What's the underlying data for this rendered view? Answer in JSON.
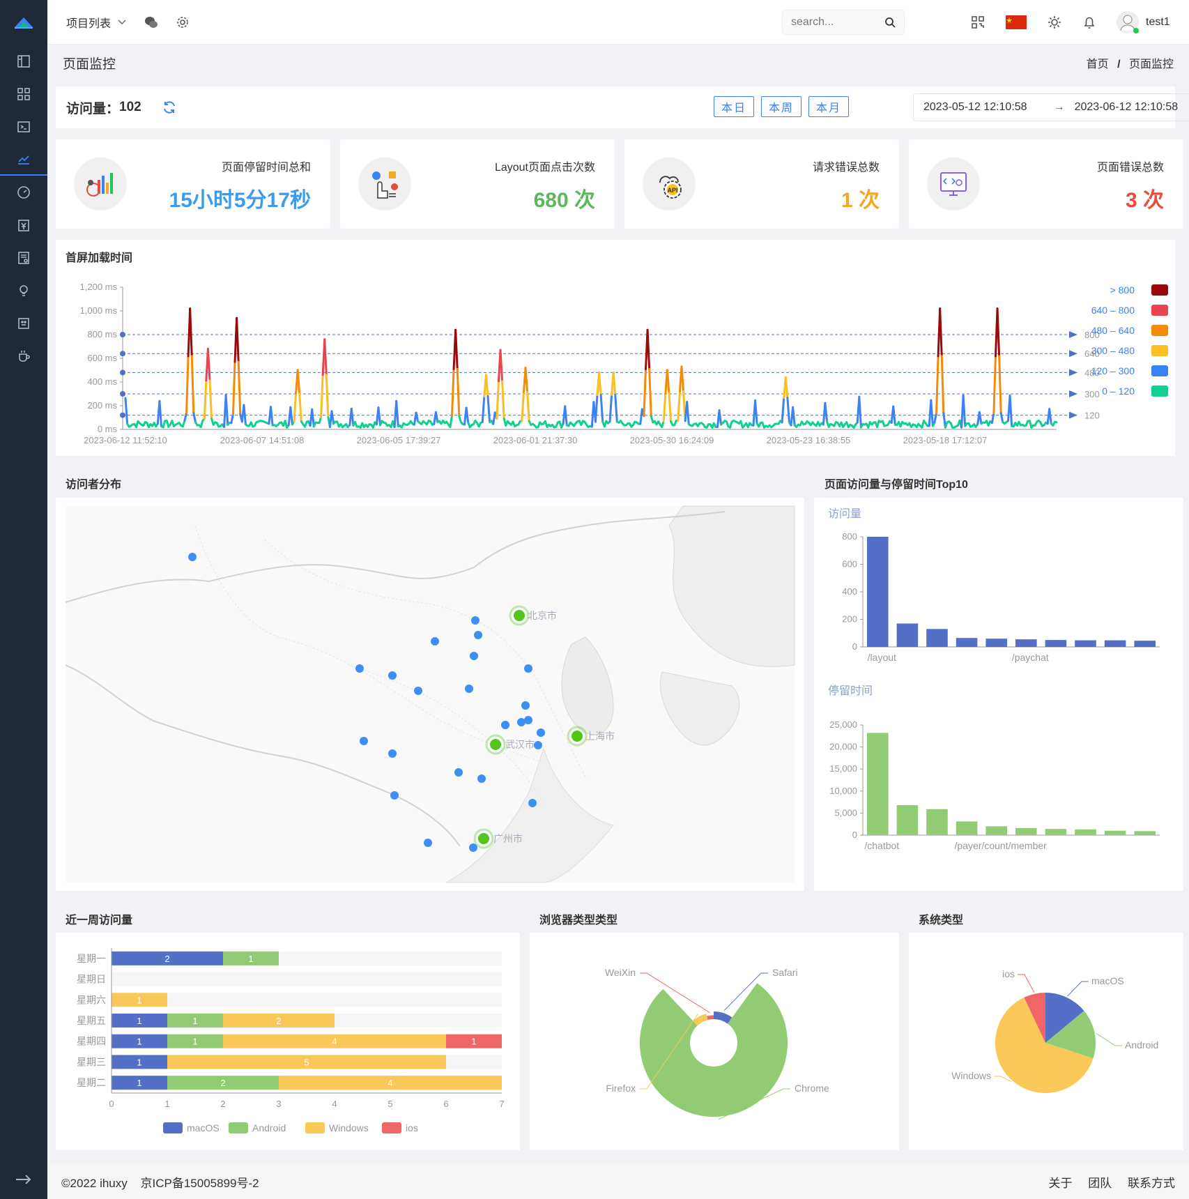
{
  "header": {
    "project_menu": "项目列表",
    "search_placeholder": "search...",
    "username": "test1"
  },
  "page": {
    "title": "页面监控",
    "breadcrumb_home": "首页",
    "breadcrumb_sep": "/",
    "breadcrumb_current": "页面监控"
  },
  "filter": {
    "pv_label": "访问量：",
    "pv_value": "102",
    "btn_today": "本日",
    "btn_week": "本周",
    "btn_month": "本月",
    "start": "2023-05-12 12:10:58",
    "arrow": "→",
    "end": "2023-06-12 12:10:58"
  },
  "stats": [
    {
      "label": "页面停留时间总和",
      "value": "15小时5分17秒",
      "color": "#3b9bef"
    },
    {
      "label": "Layout页面点击次数",
      "value": "680 次",
      "color": "#5cb85c"
    },
    {
      "label": "请求错误总数",
      "value": "1 次",
      "color": "#f5a623"
    },
    {
      "label": "页面错误总数",
      "value": "3 次",
      "color": "#e74c3c"
    }
  ],
  "sections": {
    "load_time": "首屏加载时间",
    "visitors": "访问者分布",
    "top10": "页面访问量与停留时间Top10",
    "week": "近一周访问量",
    "browser": "浏览器类型类型",
    "os": "系统类型"
  },
  "chart_data": [
    {
      "type": "line",
      "title": "首屏加载时间",
      "ylim": [
        0,
        1200
      ],
      "yticks": [
        "1,200 ms",
        "1,000 ms",
        "800 ms",
        "600 ms",
        "400 ms",
        "200 ms",
        "0 ms"
      ],
      "x_labels": [
        "2023-06-12 11:52:10",
        "2023-06-07 14:51:08",
        "2023-06-05 17:39:27",
        "2023-06-01 21:37:30",
        "2023-05-30 16:24:09",
        "2023-05-23 16:38:55",
        "2023-05-18 17:12:07"
      ],
      "thresholds": [
        800,
        640,
        480,
        300,
        120
      ],
      "legend": [
        {
          "label": "> 800",
          "color": "#9b0a0a"
        },
        {
          "label": "640 – 800",
          "color": "#e8434f"
        },
        {
          "label": "480 – 640",
          "color": "#f58a07"
        },
        {
          "label": "300 – 480",
          "color": "#fbbf24"
        },
        {
          "label": "120 – 300",
          "color": "#3b82f6"
        },
        {
          "label": "0 – 120",
          "color": "#10d090"
        }
      ],
      "peaks": [
        {
          "pos": 0.07,
          "value": 1020
        },
        {
          "pos": 0.088,
          "value": 680
        },
        {
          "pos": 0.12,
          "value": 940
        },
        {
          "pos": 0.185,
          "value": 500
        },
        {
          "pos": 0.213,
          "value": 760
        },
        {
          "pos": 0.354,
          "value": 840
        },
        {
          "pos": 0.388,
          "value": 460
        },
        {
          "pos": 0.402,
          "value": 670
        },
        {
          "pos": 0.43,
          "value": 520
        },
        {
          "pos": 0.509,
          "value": 480
        },
        {
          "pos": 0.525,
          "value": 480
        },
        {
          "pos": 0.56,
          "value": 840
        },
        {
          "pos": 0.582,
          "value": 500
        },
        {
          "pos": 0.597,
          "value": 530
        },
        {
          "pos": 0.71,
          "value": 440
        },
        {
          "pos": 0.875,
          "value": 1020
        },
        {
          "pos": 0.937,
          "value": 1020
        }
      ]
    },
    {
      "type": "bar",
      "title": "访问量",
      "categories": [
        "/layout",
        "",
        "",
        "",
        "",
        "/paychat",
        "",
        "",
        "",
        ""
      ],
      "values": [
        800,
        170,
        130,
        65,
        60,
        55,
        50,
        48,
        48,
        45
      ],
      "ylim": [
        0,
        800
      ],
      "yticks": [
        "800",
        "600",
        "400",
        "200",
        "0"
      ],
      "color": "#5470c6"
    },
    {
      "type": "bar",
      "title": "停留时间",
      "categories": [
        "/chatbot",
        "",
        "",
        "",
        "/payer/count/member",
        "",
        "",
        "",
        "",
        ""
      ],
      "values": [
        23200,
        6800,
        5900,
        3100,
        2000,
        1600,
        1400,
        1300,
        1000,
        900
      ],
      "ylim": [
        0,
        25000
      ],
      "yticks": [
        "25,000",
        "20,000",
        "15,000",
        "10,000",
        "5,000",
        "0"
      ],
      "color": "#91cc75"
    },
    {
      "type": "bar",
      "title": "近一周访问量",
      "orientation": "horizontal-stacked",
      "categories": [
        "星期一",
        "星期日",
        "星期六",
        "星期五",
        "星期四",
        "星期三",
        "星期二"
      ],
      "series": [
        {
          "name": "macOS",
          "values": [
            2,
            0,
            0,
            1,
            1,
            1,
            1
          ],
          "color": "#5470c6"
        },
        {
          "name": "Android",
          "values": [
            1,
            0,
            0,
            1,
            1,
            0,
            2
          ],
          "color": "#91cc75"
        },
        {
          "name": "Windows",
          "values": [
            0,
            0,
            1,
            2,
            4,
            5,
            4
          ],
          "color": "#fac858"
        },
        {
          "name": "ios",
          "values": [
            0,
            0,
            0,
            0,
            1,
            0,
            0
          ],
          "color": "#ee6666"
        }
      ],
      "xlim": [
        0,
        7
      ],
      "xticks": [
        "0",
        "1",
        "2",
        "3",
        "4",
        "5",
        "6",
        "7"
      ]
    },
    {
      "type": "pie",
      "title": "浏览器类型类型",
      "slices": [
        {
          "label": "Safari",
          "value": 10,
          "color": "#5470c6"
        },
        {
          "label": "Chrome",
          "value": 78,
          "color": "#91cc75"
        },
        {
          "label": "Firefox",
          "value": 8,
          "color": "#fac858"
        },
        {
          "label": "WeiXin",
          "value": 4,
          "color": "#ee6666"
        }
      ]
    },
    {
      "type": "pie",
      "title": "系统类型",
      "slices": [
        {
          "label": "macOS",
          "value": 14,
          "color": "#5470c6"
        },
        {
          "label": "Android",
          "value": 16,
          "color": "#91cc75"
        },
        {
          "label": "Windows",
          "value": 63,
          "color": "#fac858"
        },
        {
          "label": "ios",
          "value": 7,
          "color": "#ee6666"
        }
      ]
    }
  ],
  "map": {
    "cities": [
      "北京市",
      "上海市",
      "武汉市",
      "广州市"
    ]
  },
  "footer": {
    "copyright": "©2022 ihuxy",
    "icp": "京ICP备15005899号-2",
    "about": "关于",
    "team": "团队",
    "contact": "联系方式"
  }
}
